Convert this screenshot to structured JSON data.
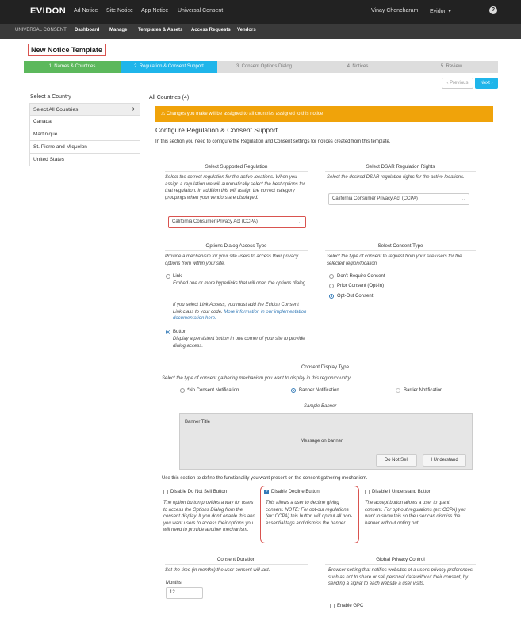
{
  "topbar": {
    "logo": "EVIDON",
    "nav": [
      "Ad Notice",
      "Site Notice",
      "App Notice",
      "Universal Consent"
    ],
    "user": "Vinay Chencharam",
    "account": "Evidon ▾",
    "help": "?"
  },
  "subbar": {
    "brand": "UNIVERSAL CONSENT",
    "items": [
      "Dashboard",
      "Manage",
      "Templates & Assets",
      "Access Requests",
      "Vendors"
    ]
  },
  "page_title": "New Notice Template",
  "steps": [
    {
      "label": "1. Names & Countries",
      "color": "#5cb85c"
    },
    {
      "label": "2. Regulation & Consent Support",
      "color": "#1fb5ea"
    },
    {
      "label": "3. Consent Options Dialog",
      "color": "#ddd"
    },
    {
      "label": "4. Notices",
      "color": "#ddd"
    },
    {
      "label": "5. Review",
      "color": "#ddd"
    }
  ],
  "nav_buttons": {
    "previous": "‹ Previous",
    "next": "Next ›"
  },
  "countries": {
    "title": "Select a Country",
    "items": [
      "Select All Countries",
      "Canada",
      "Martinique",
      "St. Pierre and Miquelon",
      "United States"
    ],
    "chevron": "›"
  },
  "all_countries": "All Countries (4)",
  "warning": "⚠  Changes you make will be assigned to all countries assigned to this notice",
  "section": {
    "title": "Configure Regulation & Consent Support",
    "intro": "In this section you need to configure the Regulation and Consent settings for notices created from this template."
  },
  "regulation": {
    "header": "Select Supported Regulation",
    "desc": "Select the correct regulation for the active locations. When you assign a regulation we will automatically select the best options for that regulation. In addition this will assign the correct category groupings when your vendors are displayed.",
    "value": "California Consumer Privacy Act (CCPA)"
  },
  "dsar": {
    "header": "Select DSAR Regulation Rights",
    "desc": "Select the desired DSAR regulation rights for the active locations.",
    "value": "California Consumer Privacy Act (CCPA)"
  },
  "access": {
    "header": "Options Dialog Access Type",
    "desc": "Provide a mechanism for your site users to access their privacy options from within your site.",
    "link_label": "Link",
    "link_desc": "Embed one or more hyperlinks that will open the options dialog.",
    "link_note": "If you select Link Access, you must add the Evidon Consent Link class to your code.",
    "link_more": "More information in our implementation documentation here.",
    "button_label": "Button",
    "button_desc": "Display a persistent button in one corner of your site to provide dialog access."
  },
  "consent_type": {
    "header": "Select Consent Type",
    "desc": "Select the type of consent to request from your site users for the selected region/location.",
    "options": [
      "Don't Require Consent",
      "Prior Consent (Opt-In)",
      "Opt-Out Consent"
    ],
    "selected": 2
  },
  "display": {
    "header": "Consent Display Type",
    "desc": "Select the type of consent gathering mechanism you want to display in this region/country.",
    "options": [
      "*No Consent Notification",
      "Banner Notification",
      "Barrier Notification"
    ],
    "sample": "Sample Banner",
    "banner_title": "Banner Title",
    "banner_message": "Message on banner",
    "banner_btn1": "Do Not Sell",
    "banner_btn2": "I Understand"
  },
  "functionality": "Use this section to define the functionality you want present on the consent gathering mechanism.",
  "options": [
    {
      "label": "Disable Do Not Sell Button",
      "checked": false,
      "desc": "The option button provides a way for users to access the Options Dialog from the consent display. If you don't enable this and you want users to access their options you will need to provide another mechanism."
    },
    {
      "label": "Disable Decline Button",
      "checked": true,
      "desc": "This allows a user to decline giving consent. NOTE: For opt-out regulations (ex: CCPA) this button will optout all non-essential tags and dismiss the banner."
    },
    {
      "label": "Disable I Understand Button",
      "checked": false,
      "desc": "The accept button allows a user to grant consent. For opt-out regulations (ex: CCPA) you want to show this so the user can dismiss the banner without opting out."
    }
  ],
  "duration": {
    "header": "Consent Duration",
    "desc": "Set the time (in months) the user consent will last.",
    "label": "Months",
    "value": "12"
  },
  "gpc": {
    "header": "Global Privacy Control",
    "desc": "Browser setting that notifies websites of a user's privacy preferences, such as not to share or sell personal data without their consent, by sending a signal to each website a user visits.",
    "label": "Enable GPC"
  }
}
